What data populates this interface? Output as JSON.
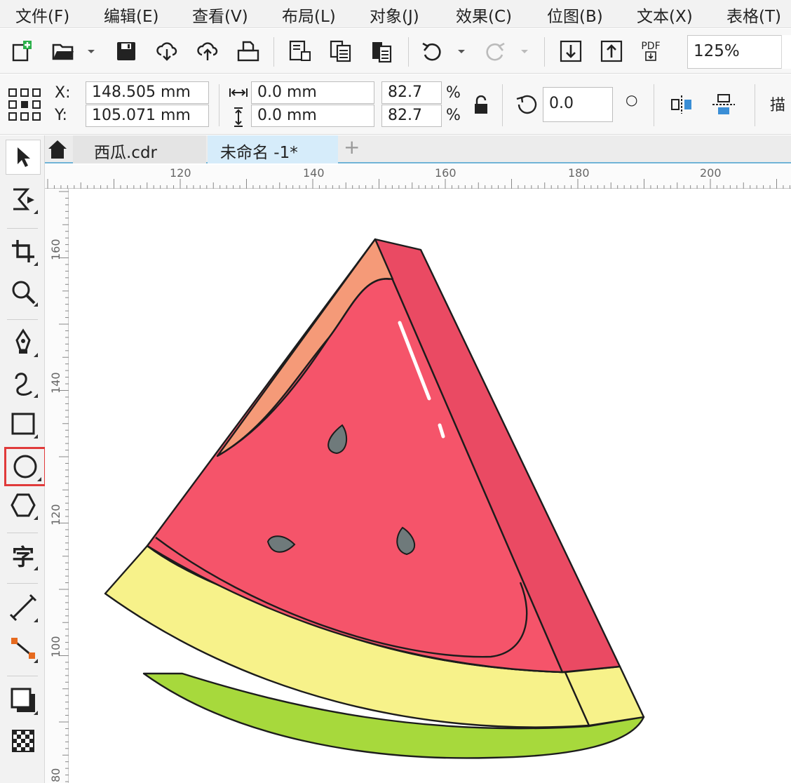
{
  "menu": {
    "file": "文件(F)",
    "edit": "编辑(E)",
    "view": "查看(V)",
    "layout": "布局(L)",
    "object": "对象(J)",
    "effects": "效果(C)",
    "bitmaps": "位图(B)",
    "text": "文本(X)",
    "table": "表格(T)"
  },
  "toolbar": {
    "pdf_label": "PDF",
    "zoom": "125%"
  },
  "properties": {
    "x_label": "X:",
    "y_label": "Y:",
    "x_value": "148.505 mm",
    "y_value": "105.071 mm",
    "width_value": "0.0 mm",
    "height_value": "0.0 mm",
    "scale_x": "82.7",
    "scale_y": "82.7",
    "percent": "%",
    "rotation": "0.0",
    "degree_symbol": "○",
    "more_label": "描"
  },
  "tabs": [
    {
      "label": "西瓜.cdr",
      "active": false
    },
    {
      "label": "未命名 -1*",
      "active": true
    }
  ],
  "tab_add": "+",
  "ruler": {
    "horizontal": [
      "120",
      "140",
      "160",
      "180",
      "200"
    ],
    "vertical": [
      "160",
      "140",
      "120",
      "100",
      "80"
    ]
  },
  "toolbox": {
    "selected_tool": "ellipse-tool",
    "text_tool_glyph": "字"
  },
  "colors": {
    "flesh": "#f5546a",
    "flesh_dark": "#cf3a50",
    "side": "#ea4a63",
    "highlight_orange": "#f59a78",
    "rind_light": "#f7f28a",
    "rind_green": "#a7d93c",
    "seed": "#6f7a7b",
    "highlight_box": "#e03a3a",
    "tab_accent": "#6fb3d6"
  }
}
